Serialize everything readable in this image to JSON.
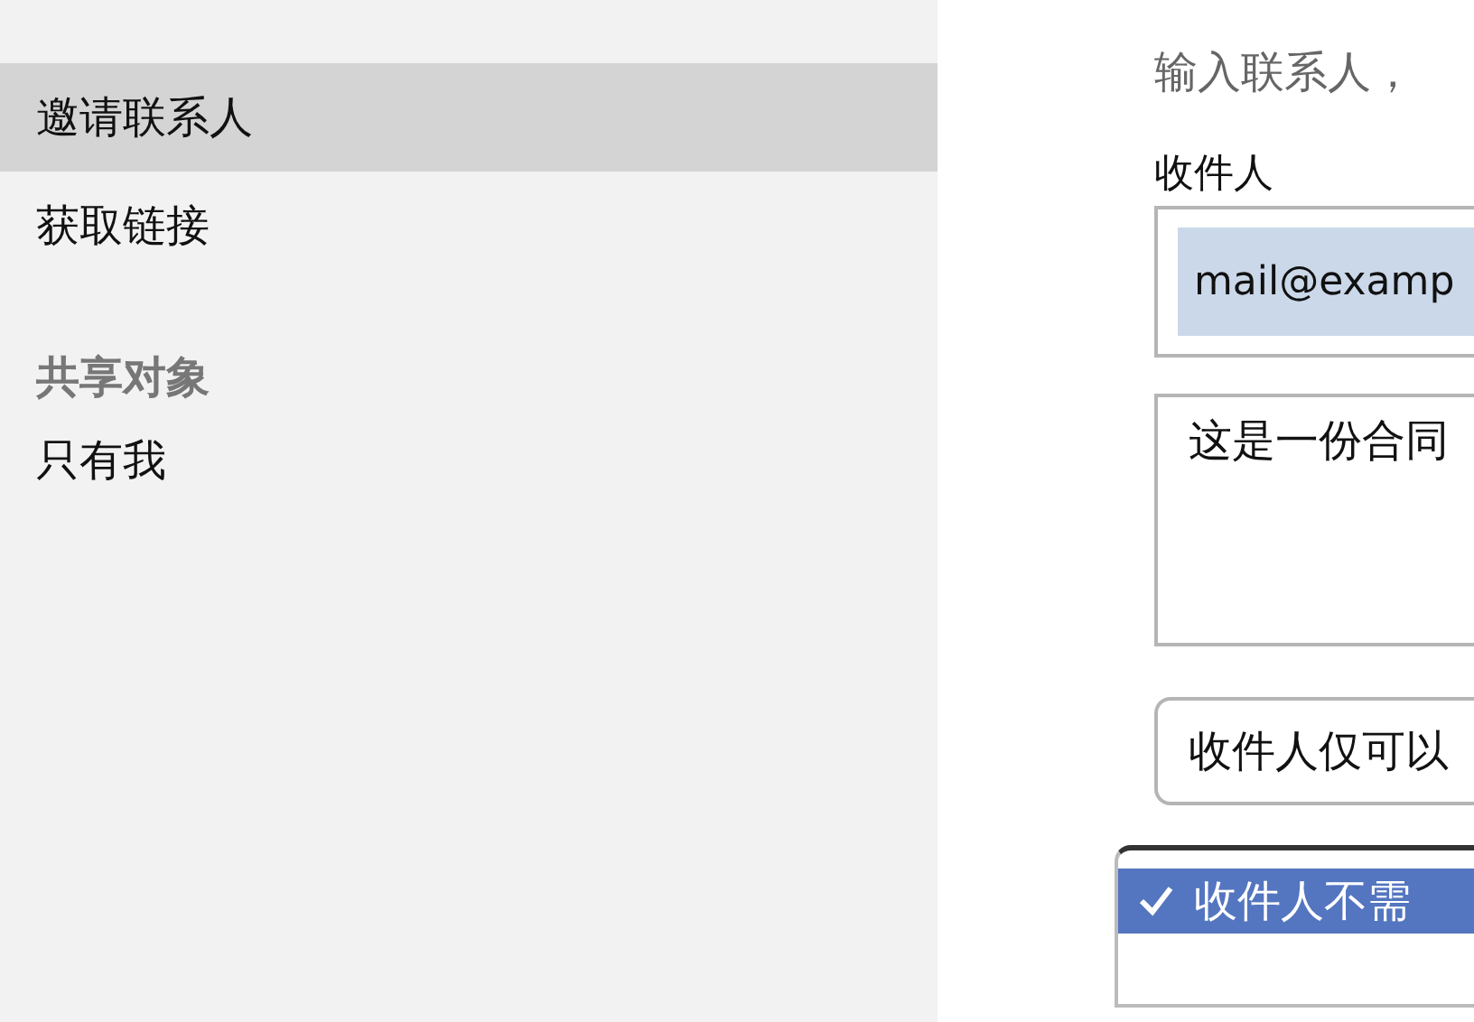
{
  "sidebar": {
    "items": [
      {
        "label": "邀请联系人",
        "selected": true
      },
      {
        "label": "获取链接",
        "selected": false
      }
    ],
    "sections": [
      {
        "heading": "共享对象",
        "items": [
          {
            "label": "只有我"
          }
        ]
      }
    ]
  },
  "form": {
    "hint": "输入联系人，",
    "recipients_label": "收件人",
    "recipients": [
      {
        "value": "mail@examp",
        "selected": true
      }
    ],
    "message": "这是一份合同",
    "permission": "收件人仅可以",
    "option": {
      "label": "收件人不需",
      "checked": true
    }
  }
}
